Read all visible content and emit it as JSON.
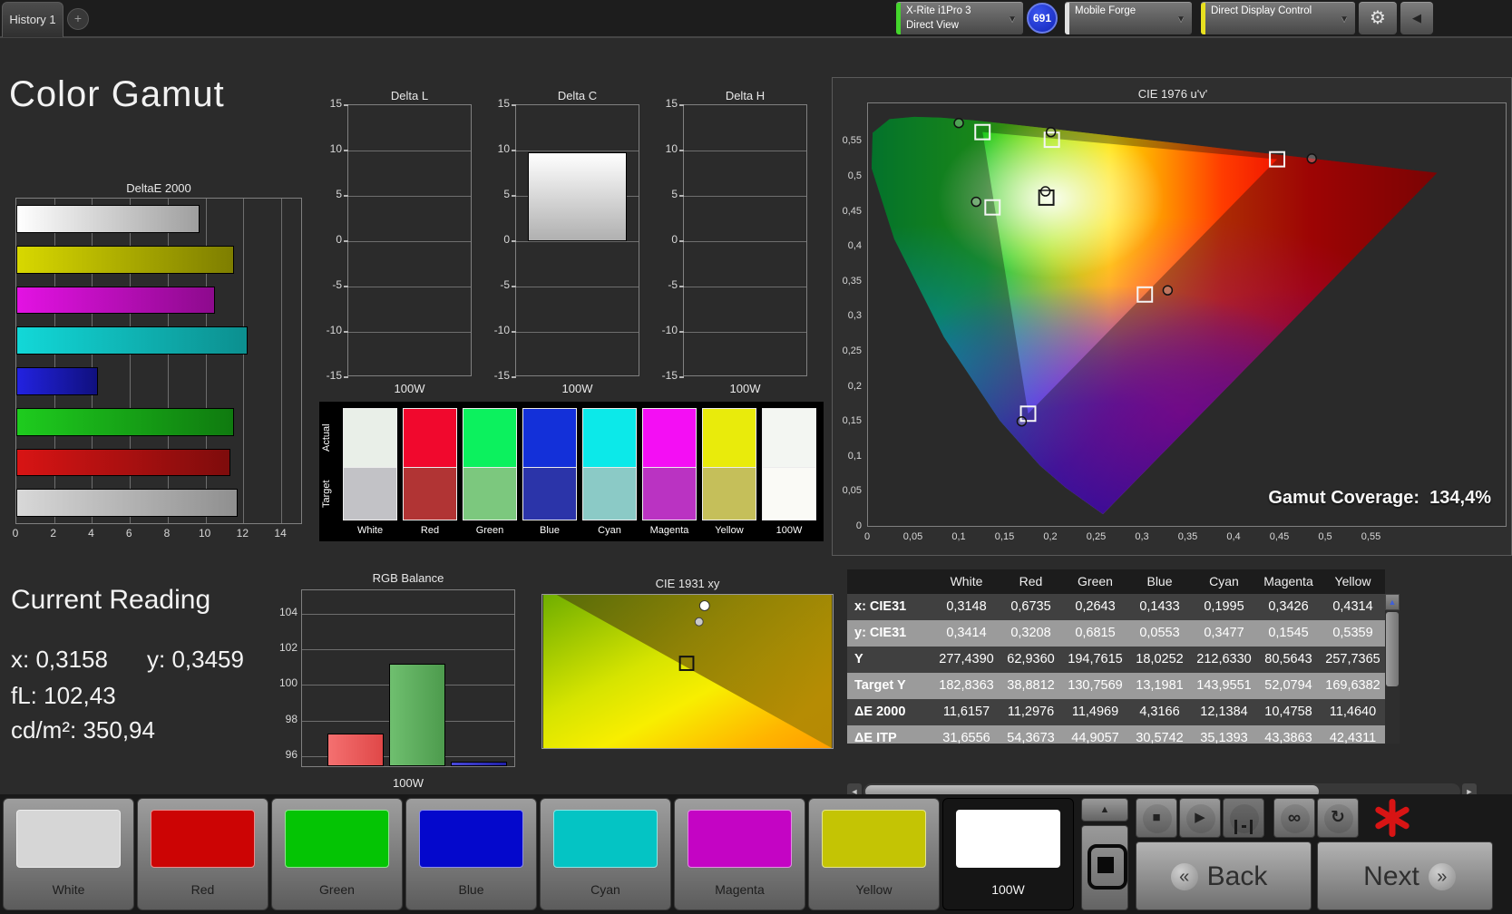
{
  "topbar": {
    "tab_label": "History 1",
    "add_tab_label": "+",
    "meter_dropdown": {
      "line1": "X-Rite i1Pro 3",
      "line2": "Direct View",
      "stripe_color": "#44d62c"
    },
    "badge": "691",
    "workflow_dropdown": {
      "label": "Mobile Forge",
      "stripe_color": "#e0e0e0"
    },
    "control_dropdown": {
      "label": "Direct Display Control",
      "stripe_color": "#e8e020"
    }
  },
  "page_title": "Color Gamut",
  "chart_data": [
    {
      "type": "bar",
      "title": "DeltaE 2000",
      "orientation": "horizontal",
      "xticks": [
        0,
        2,
        4,
        6,
        8,
        10,
        12,
        14
      ],
      "xmax": 15.05,
      "bars": [
        {
          "name": "White",
          "value": 9.7,
          "c1": "#ffffff",
          "c2": "#9f9f9f"
        },
        {
          "name": "Yellow",
          "value": 11.5,
          "c1": "#d8d800",
          "c2": "#7e7e00"
        },
        {
          "name": "Magenta",
          "value": 10.5,
          "c1": "#e312e3",
          "c2": "#8d0a8d"
        },
        {
          "name": "Cyan",
          "value": 12.2,
          "c1": "#12d8d8",
          "c2": "#0c8f8f"
        },
        {
          "name": "Blue",
          "value": 4.3,
          "c1": "#2222e0",
          "c2": "#10107e"
        },
        {
          "name": "Green",
          "value": 11.5,
          "c1": "#1ecc1e",
          "c2": "#0f7a0f"
        },
        {
          "name": "Red",
          "value": 11.3,
          "c1": "#d81414",
          "c2": "#7e0c0c"
        },
        {
          "name": "100W",
          "value": 11.7,
          "c1": "#d8d8d8",
          "c2": "#8f8f8f"
        }
      ]
    },
    {
      "type": "bar",
      "group_title": "Delta charts",
      "yticks": [
        15,
        10,
        5,
        0,
        -5,
        -10,
        -15
      ],
      "ymin": -15,
      "ymax": 15,
      "charts": [
        {
          "title": "Delta L",
          "xlabel": "100W",
          "bar_value": null
        },
        {
          "title": "Delta C",
          "xlabel": "100W",
          "bar_value": 9.8
        },
        {
          "title": "Delta H",
          "xlabel": "100W",
          "bar_value": null
        }
      ]
    },
    {
      "type": "bar",
      "title": "RGB Balance",
      "xlabel": "100W",
      "yticks": [
        104,
        102,
        100,
        98,
        96
      ],
      "ymin": 95.45,
      "ymax": 105.3,
      "bars": [
        {
          "name": "red",
          "value": 97.3,
          "c1": "#f47070",
          "c2": "#e04848"
        },
        {
          "name": "green",
          "value": 101.2,
          "c1": "#6fbf6f",
          "c2": "#4d9b4d"
        },
        {
          "name": "blue",
          "value": 95.7,
          "c1": "#4848d8",
          "c2": "#2020a8"
        }
      ]
    }
  ],
  "swatch_panel": {
    "row_labels": [
      "Actual",
      "Target"
    ],
    "columns": [
      {
        "label": "White",
        "actual": "#e9efe8",
        "target": "#c2c2c6"
      },
      {
        "label": "Red",
        "actual": "#f1082d",
        "target": "#b13434"
      },
      {
        "label": "Green",
        "actual": "#0cf15e",
        "target": "#7cc87e"
      },
      {
        "label": "Blue",
        "actual": "#1330d9",
        "target": "#2b34a9"
      },
      {
        "label": "Cyan",
        "actual": "#0ce9e9",
        "target": "#8bcac6"
      },
      {
        "label": "Magenta",
        "actual": "#f40ef4",
        "target": "#ba33c2"
      },
      {
        "label": "Yellow",
        "actual": "#e9eb0b",
        "target": "#c5bf5a"
      },
      {
        "label": "100W",
        "actual": "#f3f6f2",
        "target": "#fafaf6"
      }
    ]
  },
  "cie1976": {
    "title": "CIE 1976 u'v'",
    "coverage_label": "Gamut Coverage:",
    "coverage_value": "134,4%",
    "xticks": [
      "0",
      "0,05",
      "0,1",
      "0,15",
      "0,2",
      "0,25",
      "0,3",
      "0,35",
      "0,4",
      "0,45",
      "0,5",
      "0,55"
    ],
    "yticks": [
      "0",
      "0,05",
      "0,1",
      "0,15",
      "0,2",
      "0,25",
      "0,3",
      "0,35",
      "0,4",
      "0,45",
      "0,5",
      "0,55"
    ],
    "reference_triangle": [
      [
        0.448,
        0.526
      ],
      [
        0.125,
        0.565
      ],
      [
        0.175,
        0.161
      ]
    ],
    "points": [
      {
        "name": "green",
        "square": [
          0.125,
          0.565
        ],
        "circle": [
          0.099,
          0.578
        ]
      },
      {
        "name": "yellow",
        "square": [
          0.201,
          0.554
        ],
        "circle": [
          0.2,
          0.565
        ]
      },
      {
        "name": "red",
        "square": [
          0.448,
          0.526
        ],
        "circle": [
          0.486,
          0.527
        ]
      },
      {
        "name": "white",
        "square": [
          0.195,
          0.471
        ],
        "circle": [
          0.194,
          0.48
        ],
        "square_dark": true
      },
      {
        "name": "cyan",
        "square": [
          0.136,
          0.457
        ],
        "circle": [
          0.118,
          0.465
        ]
      },
      {
        "name": "magenta",
        "square": [
          0.303,
          0.332
        ],
        "circle": [
          0.328,
          0.338
        ]
      },
      {
        "name": "blue",
        "square": [
          0.175,
          0.161
        ],
        "circle": [
          0.168,
          0.15
        ]
      }
    ]
  },
  "current_reading": {
    "title": "Current Reading",
    "x": "x: 0,3158",
    "y": "y: 0,3459",
    "fl": "fL: 102,43",
    "cd": "cd/m²: 350,94"
  },
  "cie1931": {
    "title": "CIE 1931 xy",
    "white_circle": [
      0.559,
      0.071
    ],
    "gray_circle": [
      0.54,
      0.176
    ],
    "target_square": [
      0.497,
      0.447
    ]
  },
  "results_table": {
    "headers": [
      "White",
      "Red",
      "Green",
      "Blue",
      "Cyan",
      "Magenta",
      "Yellow"
    ],
    "rows": [
      {
        "label": "x: CIE31",
        "light": false,
        "values": [
          "0,3148",
          "0,6735",
          "0,2643",
          "0,1433",
          "0,1995",
          "0,3426",
          "0,4314"
        ]
      },
      {
        "label": "y: CIE31",
        "light": true,
        "values": [
          "0,3414",
          "0,3208",
          "0,6815",
          "0,0553",
          "0,3477",
          "0,1545",
          "0,5359"
        ]
      },
      {
        "label": "Y",
        "light": false,
        "values": [
          "277,4390",
          "62,9360",
          "194,7615",
          "18,0252",
          "212,6330",
          "80,5643",
          "257,7365"
        ]
      },
      {
        "label": "Target Y",
        "light": true,
        "values": [
          "182,8363",
          "38,8812",
          "130,7569",
          "13,1981",
          "143,9551",
          "52,0794",
          "169,6382"
        ]
      },
      {
        "label": "ΔE 2000",
        "light": false,
        "values": [
          "11,6157",
          "11,2976",
          "11,4969",
          "4,3166",
          "12,1384",
          "10,4758",
          "11,4640"
        ]
      },
      {
        "label": "ΔE ITP",
        "light": true,
        "values": [
          "31,6556",
          "54,3673",
          "44,9057",
          "30,5742",
          "35,1393",
          "43,3863",
          "42,4311"
        ],
        "partial": true
      }
    ]
  },
  "bottom_bar": {
    "patches": [
      {
        "label": "White",
        "color": "#d6d6d6",
        "selected": false
      },
      {
        "label": "Red",
        "color": "#cc0404",
        "selected": false
      },
      {
        "label": "Green",
        "color": "#04c404",
        "selected": false
      },
      {
        "label": "Blue",
        "color": "#0408cc",
        "selected": false
      },
      {
        "label": "Cyan",
        "color": "#04c4c4",
        "selected": false
      },
      {
        "label": "Magenta",
        "color": "#c404c4",
        "selected": false
      },
      {
        "label": "Yellow",
        "color": "#c4c404",
        "selected": false
      },
      {
        "label": "100W",
        "color": "#ffffff",
        "selected": true
      }
    ],
    "back_label": "Back",
    "next_label": "Next"
  }
}
